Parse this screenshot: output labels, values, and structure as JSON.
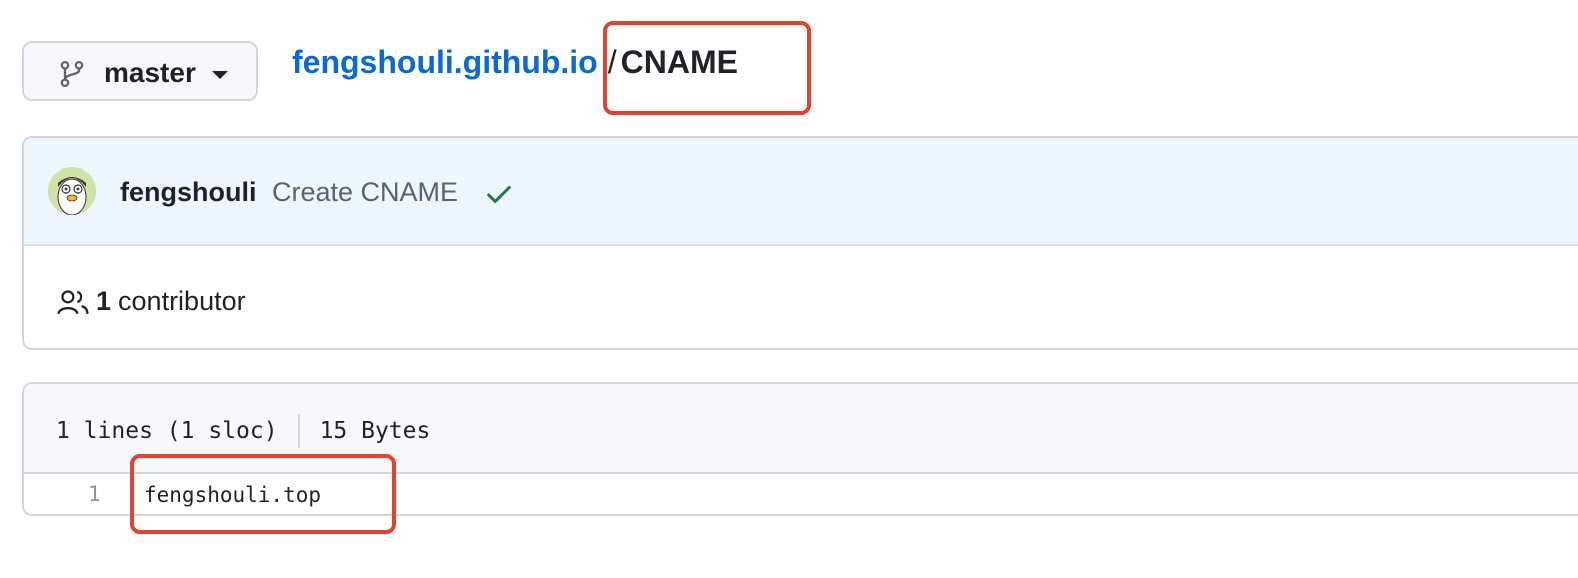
{
  "branch": {
    "label": "master",
    "icon": "git-branch-icon"
  },
  "breadcrumb": {
    "repo": "fengshouli.github.io",
    "separator": "/",
    "file": "CNAME"
  },
  "commit": {
    "author": "fengshouli",
    "message": "Create CNAME",
    "status_icon": "check-icon",
    "status_color": "#1a7f37"
  },
  "contributors": {
    "count": "1",
    "label": "contributor",
    "icon": "people-icon"
  },
  "file": {
    "lines": "1 lines (1 sloc)",
    "size": "15 Bytes",
    "code": [
      {
        "num": "1",
        "text": "fengshouli.top"
      }
    ]
  },
  "colors": {
    "link": "#0969da",
    "annotation": "#e0442f",
    "commit_bg": "#eef6ff"
  }
}
